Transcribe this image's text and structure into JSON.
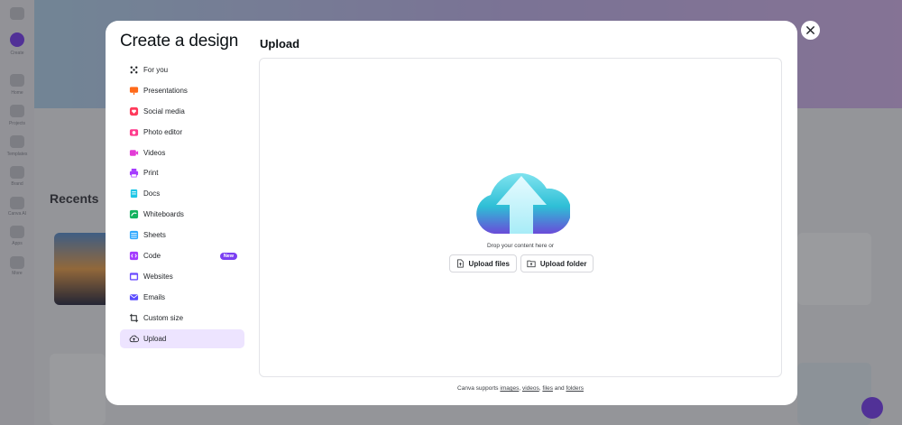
{
  "background": {
    "recent_title": "Recents",
    "rail_labels": [
      "Create",
      "Home",
      "Projects",
      "Templates",
      "Brand",
      "Canva AI",
      "Apps",
      "More"
    ]
  },
  "modal": {
    "title": "Create a design",
    "section_title": "Upload",
    "nav_items": [
      {
        "label": "For you",
        "icon": "sparkle-icon",
        "color": "#1f2226"
      },
      {
        "label": "Presentations",
        "icon": "presentation-icon",
        "color": "#ff6a1a"
      },
      {
        "label": "Social media",
        "icon": "heart-icon",
        "color": "#ff3b5c"
      },
      {
        "label": "Photo editor",
        "icon": "camera-icon",
        "color": "#ff3b8d"
      },
      {
        "label": "Videos",
        "icon": "video-icon",
        "color": "#e23bd6"
      },
      {
        "label": "Print",
        "icon": "printer-icon",
        "color": "#a53bff"
      },
      {
        "label": "Docs",
        "icon": "doc-icon",
        "color": "#1ec6e6"
      },
      {
        "label": "Whiteboards",
        "icon": "whiteboard-icon",
        "color": "#14b35f"
      },
      {
        "label": "Sheets",
        "icon": "sheet-icon",
        "color": "#2fa8ff"
      },
      {
        "label": "Code",
        "icon": "code-icon",
        "color": "#a53bff",
        "badge": "New"
      },
      {
        "label": "Websites",
        "icon": "website-icon",
        "color": "#6b4bff"
      },
      {
        "label": "Emails",
        "icon": "email-icon",
        "color": "#5a4bff"
      },
      {
        "label": "Custom size",
        "icon": "custom-size-icon",
        "color": "#1f2226"
      },
      {
        "label": "Upload",
        "icon": "cloud-upload-icon",
        "color": "#1f2226",
        "active": true
      }
    ],
    "dropzone": {
      "prompt": "Drop your content here or",
      "upload_files_label": "Upload files",
      "upload_folder_label": "Upload folder"
    },
    "support": {
      "prefix": "Canva supports",
      "images": "images",
      "videos": "videos",
      "files": "files",
      "and": "and",
      "folders": "folders"
    }
  },
  "colors": {
    "accent": "#7b3ff2",
    "active_nav_bg": "#ede4ff"
  }
}
